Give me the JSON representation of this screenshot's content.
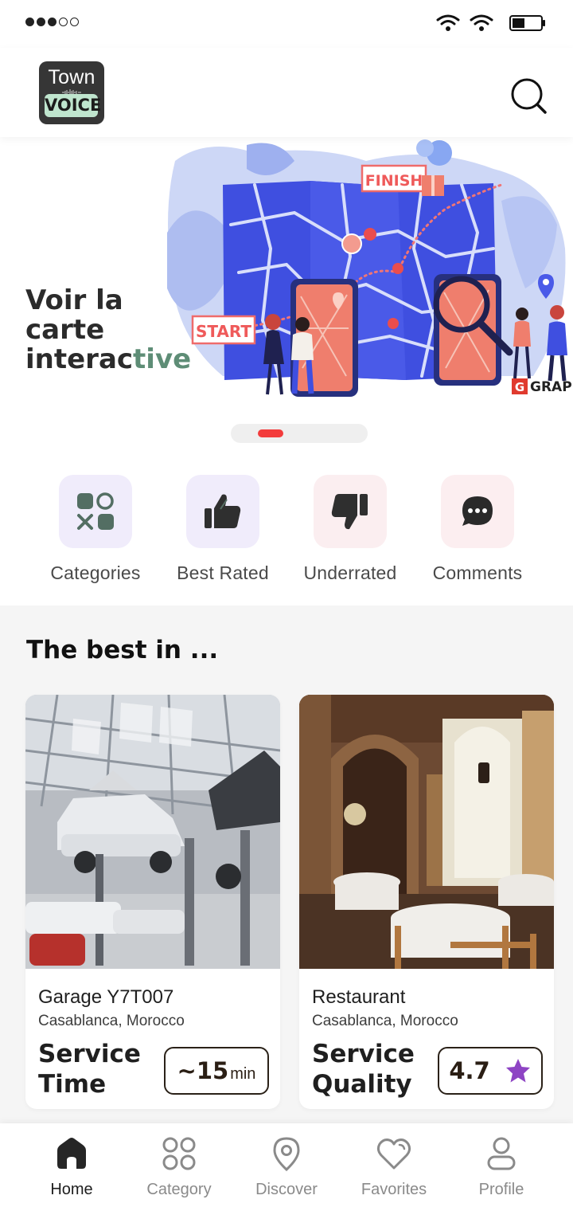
{
  "status_bar": {
    "signal": "3 of 5 bars",
    "battery_level": 0.45
  },
  "header": {
    "logo_top": "Town",
    "logo_badge": "VOICE",
    "search_icon": "search-icon"
  },
  "hero": {
    "title_line1": "Voir la",
    "title_line2": "carte",
    "title_line3_a": "interac",
    "title_line3_b": "tive",
    "illustration_start": "START",
    "illustration_finish": "FINISH",
    "illustration_watermark": "GRAP",
    "carousel_active_index": 0
  },
  "quick_actions": [
    {
      "label": "Categories",
      "icon": "categories-grid-icon",
      "bg": "#f0ecfb"
    },
    {
      "label": "Best Rated",
      "icon": "thumbs-up-icon",
      "bg": "#f0ecfb"
    },
    {
      "label": "Underrated",
      "icon": "thumbs-down-icon",
      "bg": "#fbeef0"
    },
    {
      "label": "Comments",
      "icon": "chat-bubble-icon",
      "bg": "#fceef0"
    }
  ],
  "best": {
    "title": "The best in ...",
    "cards": [
      {
        "name": "Garage Y7T007",
        "location": "Casablanca, Morocco",
        "metric_line1": "Service",
        "metric_line2": "Time",
        "value": "~15",
        "unit": "min"
      },
      {
        "name": "Restaurant",
        "location": "Casablanca, Morocco",
        "metric_line1": "Service",
        "metric_line2": "Quality",
        "value": "4.7",
        "unit": "",
        "star_color": "#8e44c4"
      }
    ]
  },
  "bottom_nav": [
    {
      "label": "Home",
      "icon": "home-icon",
      "active": true
    },
    {
      "label": "Category",
      "icon": "category-icon",
      "active": false
    },
    {
      "label": "Discover",
      "icon": "location-pin-icon",
      "active": false
    },
    {
      "label": "Favorites",
      "icon": "heart-icon",
      "active": false
    },
    {
      "label": "Profile",
      "icon": "user-icon",
      "active": false
    }
  ],
  "colors": {
    "accent_red": "#f33c3c",
    "hero_accent_green": "#5e8d76",
    "map_blue": "#3f4fe0"
  }
}
